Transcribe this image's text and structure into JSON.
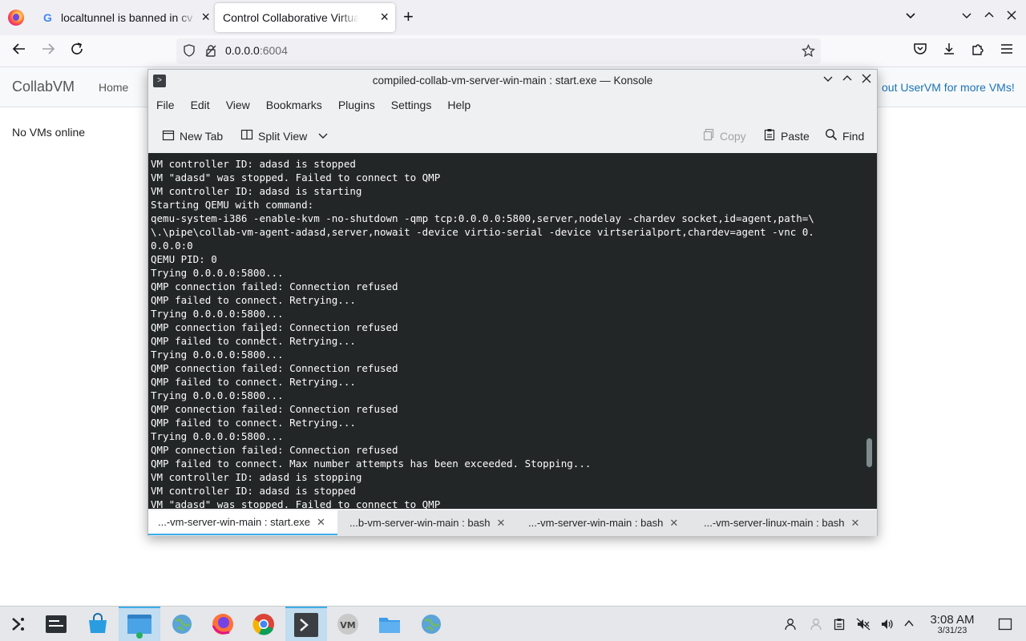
{
  "browser": {
    "tabs": [
      {
        "title": "localtunnel is banned in cv",
        "favicon": "google-icon"
      },
      {
        "title": "Control Collaborative Virtual M",
        "favicon": "none"
      }
    ],
    "url_host": "0.0.0.0",
    "url_port": ":6004"
  },
  "page": {
    "brand": "CollabVM",
    "home_link": "Home",
    "promo": "out UserVM for more VMs!",
    "status": "No VMs online"
  },
  "konsole": {
    "title": "compiled-collab-vm-server-win-main : start.exe — Konsole",
    "menu": [
      "File",
      "Edit",
      "View",
      "Bookmarks",
      "Plugins",
      "Settings",
      "Help"
    ],
    "toolbar": {
      "new_tab": "New Tab",
      "split_view": "Split View",
      "copy": "Copy",
      "paste": "Paste",
      "find": "Find"
    },
    "terminal_lines": [
      "VM controller ID: adasd is stopped",
      "VM \"adasd\" was stopped. Failed to connect to QMP",
      "VM controller ID: adasd is starting",
      "Starting QEMU with command:",
      "qemu-system-i386 -enable-kvm -no-shutdown -qmp tcp:0.0.0.0:5800,server,nodelay -chardev socket,id=agent,path=\\",
      "\\.\\pipe\\collab-vm-agent-adasd,server,nowait -device virtio-serial -device virtserialport,chardev=agent -vnc 0.",
      "0.0.0:0",
      "QEMU PID: 0",
      "Trying 0.0.0.0:5800...",
      "QMP connection failed: Connection refused",
      "QMP failed to connect. Retrying...",
      "Trying 0.0.0.0:5800...",
      "QMP connection failed: Connection refused",
      "QMP failed to connect. Retrying...",
      "Trying 0.0.0.0:5800...",
      "QMP connection failed: Connection refused",
      "QMP failed to connect. Retrying...",
      "Trying 0.0.0.0:5800...",
      "QMP connection failed: Connection refused",
      "QMP failed to connect. Retrying...",
      "Trying 0.0.0.0:5800...",
      "QMP connection failed: Connection refused",
      "QMP failed to connect. Max number attempts has been exceeded. Stopping...",
      "VM controller ID: adasd is stopping",
      "VM controller ID: adasd is stopped",
      "VM \"adasd\" was stopped. Failed to connect to QMP"
    ],
    "tabs": [
      "...-vm-server-win-main : start.exe",
      "...b-vm-server-win-main : bash",
      "...-vm-server-win-main : bash",
      "...-vm-server-linux-main : bash"
    ]
  },
  "taskbar": {
    "time": "3:08 AM",
    "date": "3/31/23",
    "apps": [
      "application-launcher-icon",
      "system-monitor-icon",
      "discover-store-icon",
      "file-manager-icon",
      "globe-icon",
      "firefox-icon",
      "chrome-icon",
      "konsole-icon",
      "virtual-machine-manager-icon",
      "folder-icon",
      "globe-icon"
    ]
  },
  "colors": {
    "terminal_bg": "#232627",
    "terminal_fg": "#fcfcfc",
    "accent": "#3daee9",
    "link": "#1a73b8"
  }
}
